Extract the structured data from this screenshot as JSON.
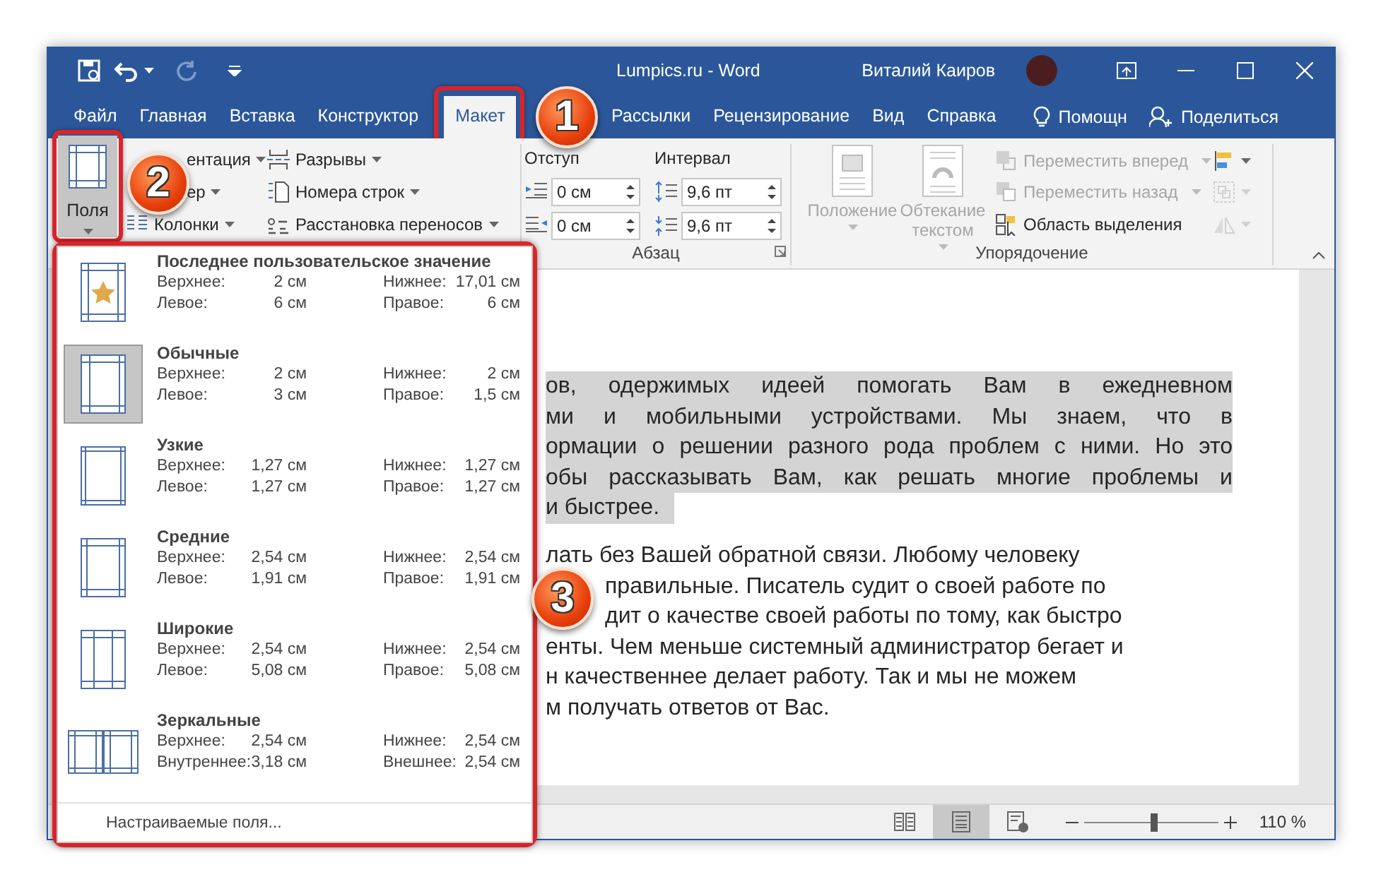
{
  "title_bar": {
    "title": "Lumpics.ru  -  Word",
    "user": "Виталий Каиров"
  },
  "tabs": [
    {
      "label": "Файл",
      "selected": false
    },
    {
      "label": "Главная",
      "selected": false
    },
    {
      "label": "Вставка",
      "selected": false
    },
    {
      "label": "Конструктор",
      "selected": false
    },
    {
      "label": "Макет",
      "selected": true
    },
    {
      "label": "Рассылки",
      "selected": false
    },
    {
      "label": "Рецензирование",
      "selected": false
    },
    {
      "label": "Вид",
      "selected": false
    },
    {
      "label": "Справка",
      "selected": false
    }
  ],
  "help_search": {
    "label": "Помощн"
  },
  "share": {
    "label": "Поделиться"
  },
  "ribbon": {
    "page_setup": {
      "margins_button": {
        "label": "Поля",
        "expanded": true
      },
      "commands": [
        {
          "kind": "orientation",
          "label": "ентация"
        },
        {
          "kind": "size",
          "label": "ер"
        },
        {
          "kind": "columns",
          "label": "Колонки"
        },
        {
          "kind": "breaks",
          "label": "Разрывы"
        },
        {
          "kind": "line_numbers",
          "label": "Номера строк"
        },
        {
          "kind": "hyphenation",
          "label": "Расстановка переносов"
        }
      ]
    },
    "paragraph": {
      "title": "Абзац",
      "indent_label": "Отступ",
      "spacing_label": "Интервал",
      "indent": [
        {
          "kind": "left",
          "value": "0 см"
        },
        {
          "kind": "right",
          "value": "0 см"
        }
      ],
      "spacing": [
        {
          "kind": "before",
          "value": "9,6 пт"
        },
        {
          "kind": "after",
          "value": "9,6 пт"
        }
      ]
    },
    "arrange": {
      "title": "Упорядочение",
      "buttons": [
        {
          "kind": "position",
          "label": "Положение",
          "disabled": true
        },
        {
          "kind": "wrap",
          "label": "Обтекание текстом",
          "disabled": true
        }
      ],
      "commands": [
        {
          "kind": "forward",
          "label": "Переместить вперед",
          "disabled": true,
          "menu": true
        },
        {
          "kind": "backward",
          "label": "Переместить назад",
          "disabled": true,
          "menu": true
        },
        {
          "kind": "selection",
          "label": "Область выделения",
          "disabled": false,
          "menu": false
        }
      ],
      "tools": [
        {
          "kind": "align",
          "disabled": false
        },
        {
          "kind": "group",
          "disabled": true
        },
        {
          "kind": "rotate",
          "disabled": true
        }
      ]
    }
  },
  "margins_menu": {
    "items": [
      {
        "kind": "last",
        "title": "Последнее пользовательское значение",
        "selected": false,
        "fields": [
          [
            "Верхнее:",
            "2 см"
          ],
          [
            "Нижнее:",
            "17,01 см"
          ],
          [
            "Левое:",
            "6 см"
          ],
          [
            "Правое:",
            "6 см"
          ]
        ]
      },
      {
        "kind": "normal",
        "title": "Обычные",
        "selected": true,
        "fields": [
          [
            "Верхнее:",
            "2 см"
          ],
          [
            "Нижнее:",
            "2 см"
          ],
          [
            "Левое:",
            "3 см"
          ],
          [
            "Правое:",
            "1,5 см"
          ]
        ]
      },
      {
        "kind": "narrow",
        "title": "Узкие",
        "selected": false,
        "fields": [
          [
            "Верхнее:",
            "1,27 см"
          ],
          [
            "Нижнее:",
            "1,27 см"
          ],
          [
            "Левое:",
            "1,27 см"
          ],
          [
            "Правое:",
            "1,27 см"
          ]
        ]
      },
      {
        "kind": "moderate",
        "title": "Средние",
        "selected": false,
        "fields": [
          [
            "Верхнее:",
            "2,54 см"
          ],
          [
            "Нижнее:",
            "2,54 см"
          ],
          [
            "Левое:",
            "1,91 см"
          ],
          [
            "Правое:",
            "1,91 см"
          ]
        ]
      },
      {
        "kind": "wide",
        "title": "Широкие",
        "selected": false,
        "fields": [
          [
            "Верхнее:",
            "2,54 см"
          ],
          [
            "Нижнее:",
            "2,54 см"
          ],
          [
            "Левое:",
            "5,08 см"
          ],
          [
            "Правое:",
            "5,08 см"
          ]
        ]
      },
      {
        "kind": "mirrored",
        "title": "Зеркальные",
        "selected": false,
        "fields": [
          [
            "Верхнее:",
            "2,54 см"
          ],
          [
            "Нижнее:",
            "2,54 см"
          ],
          [
            "Внутреннее:",
            "3,18 см"
          ],
          [
            "Внешнее:",
            "2,54 см"
          ]
        ]
      }
    ],
    "footer": "Настраиваемые поля..."
  },
  "document": {
    "paragraphs": [
      {
        "highlighted": true,
        "lines": [
          "ов, одержимых идеей помогать Вам в ежедневном",
          "ми и мобильными устройствами. Мы знаем, что в",
          "ормации о решении разного рода проблем с ними. Но это",
          "обы рассказывать Вам, как решать многие проблемы и",
          "и быстрее."
        ]
      },
      {
        "highlighted": false,
        "lines": [
          "лать без Вашей обратной связи. Любому человеку",
          "правильные. Писатель судит о своей работе по",
          "дит о качестве своей работы по тому, как быстро",
          "енты. Чем меньше системный администратор бегает и",
          "н качественнее делает работу. Так и мы не можем",
          "м получать ответов от Вас."
        ]
      }
    ]
  },
  "status_bar": {
    "views": [
      {
        "kind": "read",
        "selected": false
      },
      {
        "kind": "print",
        "selected": true
      },
      {
        "kind": "web",
        "selected": false
      }
    ],
    "zoom": {
      "level": 0.52,
      "reading": "110 %"
    }
  },
  "callouts": [
    {
      "number": "1"
    },
    {
      "number": "2"
    },
    {
      "number": "3"
    }
  ]
}
